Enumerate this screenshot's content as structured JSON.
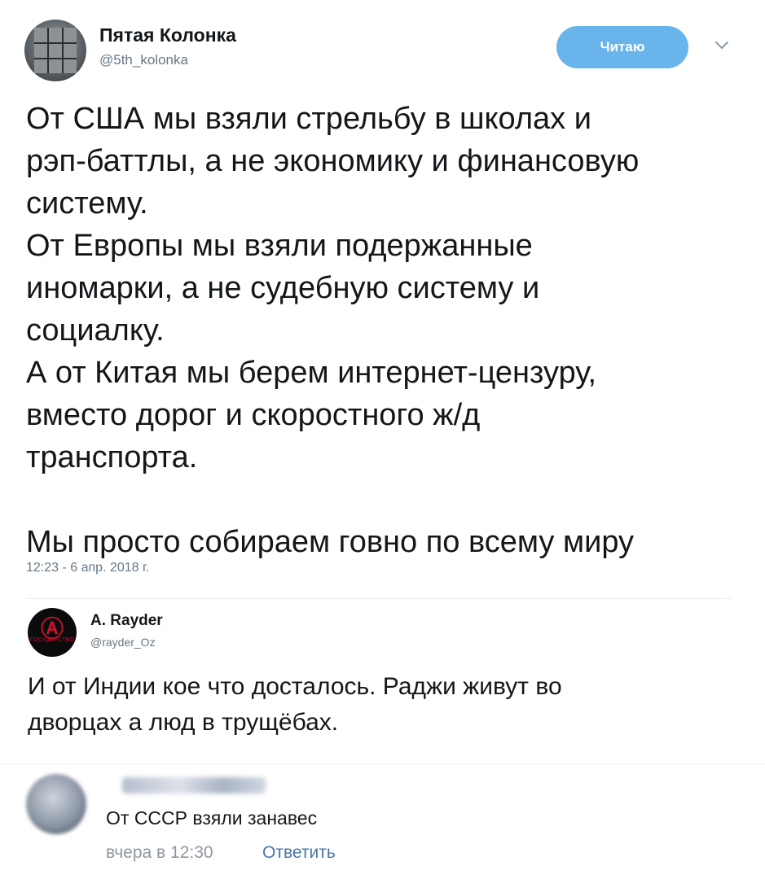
{
  "tweet": {
    "author_name": "Пятая Колонка",
    "author_handle": "@5th_kolonka",
    "follow_label": "Читаю",
    "text": "От США мы взяли стрельбу в школах и\nрэп-баттлы, а не экономику и финансовую\nсистему.\nОт Европы мы взяли подержанные\nиномарки, а не судебную систему и\nсоциалку.\nА от Китая мы берем интернет-цензуру,\nвместо дорог и скоростного ж/д\nтранспорта.\n\nМы просто собираем говно по всему миру",
    "timestamp": "12:23 - 6 апр. 2018 г."
  },
  "reply": {
    "author_name": "A. Rayder",
    "author_handle": "@rayder_Oz",
    "text": "И от Индии кое что досталось. Раджи живут во\nдворцах а люд в трущёбах."
  },
  "comment": {
    "text": "От СССР взяли занавес",
    "time": "вчера в 12:30",
    "reply_label": "Ответить"
  },
  "icons": {
    "chevron": "chevron-down-icon"
  },
  "colors": {
    "follow_button": "#69b4eb",
    "secondary_text": "#657786",
    "link": "#4a76a8"
  }
}
